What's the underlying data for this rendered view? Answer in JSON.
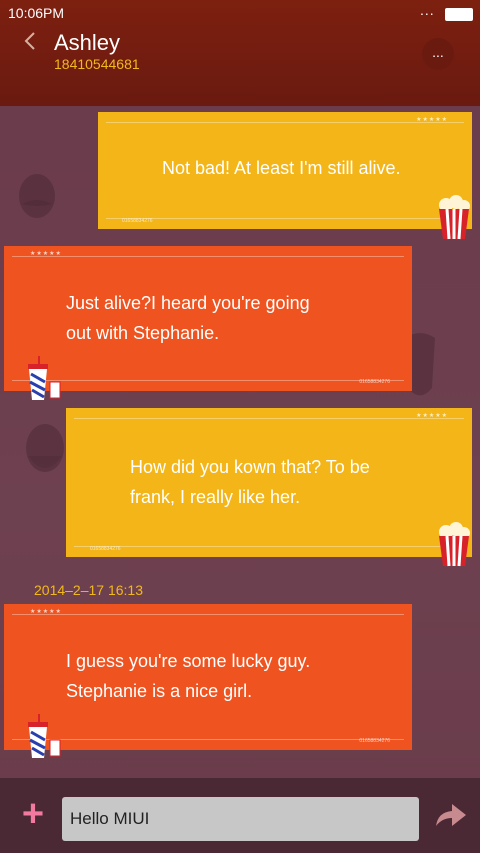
{
  "status": {
    "time": "10:06PM",
    "dots": "..."
  },
  "contact": {
    "name": "Ashley",
    "phone": "18410544681"
  },
  "header": {
    "more_label": "..."
  },
  "messages": [
    {
      "side": "right",
      "color": "yellow",
      "line1": "Not bad! At least I'm still alive.",
      "line2": "",
      "serial": "01658834276"
    },
    {
      "side": "left",
      "color": "orange",
      "line1": "Just  alive?I heard you're going",
      "line2": "out with Stephanie.",
      "serial": "01658834276"
    },
    {
      "side": "right",
      "color": "yellow",
      "line1": "How did you kown that? To be",
      "line2": "frank, I really like her.",
      "serial": "01658834276"
    },
    {
      "side": "left",
      "color": "orange",
      "line1": "I guess you're some lucky guy.",
      "line2": "Stephanie is a nice girl.",
      "serial": "01658834276"
    }
  ],
  "timestamp": "2014–2–17 16:13",
  "composer": {
    "value": "Hello MIUI"
  },
  "icons": {
    "back": "back-arrow-icon",
    "more": "more-icon",
    "add": "plus-icon",
    "send": "send-arrow-icon",
    "popcorn": "popcorn-icon",
    "drink": "soda-cup-icon"
  }
}
